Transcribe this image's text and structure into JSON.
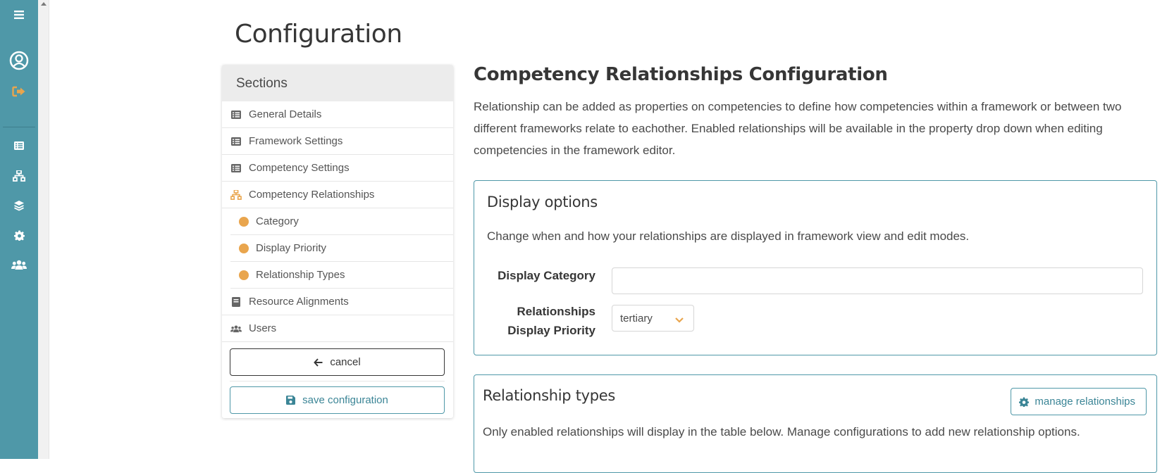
{
  "page": {
    "title": "Configuration"
  },
  "sidebar_rail": {
    "icons": [
      "menu-icon",
      "user-circle-icon",
      "sign-out-icon",
      "list-icon",
      "sitemap-icon",
      "layers-icon",
      "gear-icon",
      "users-icon"
    ]
  },
  "sections": {
    "header": "Sections",
    "items": [
      {
        "label": "General Details",
        "icon": "list-icon"
      },
      {
        "label": "Framework Settings",
        "icon": "list-icon"
      },
      {
        "label": "Competency Settings",
        "icon": "list-icon"
      },
      {
        "label": "Competency Relationships",
        "icon": "sitemap-icon"
      },
      {
        "label": "Category",
        "icon": "dot"
      },
      {
        "label": "Display Priority",
        "icon": "dot"
      },
      {
        "label": "Relationship Types",
        "icon": "dot"
      },
      {
        "label": "Resource Alignments",
        "icon": "book-icon"
      },
      {
        "label": "Users",
        "icon": "users-icon"
      }
    ],
    "cancel_label": "cancel",
    "save_label": "save configuration"
  },
  "main": {
    "title": "Competency Relationships Configuration",
    "description": "Relationship can be added as properties on competencies to define how competencies within a framework or between two different frameworks relate to eachother. Enabled relationships will be available in the property drop down when editing competencies in the framework editor.",
    "display_options": {
      "title": "Display options",
      "description": "Change when and how your relationships are displayed in framework view and edit modes.",
      "category_label": "Display Category",
      "category_value": "",
      "priority_label_line1": "Relationships",
      "priority_label_line2": "Display Priority",
      "priority_value": "tertiary"
    },
    "relationship_types": {
      "title": "Relationship types",
      "manage_label": "manage relationships",
      "description": "Only enabled relationships will display in the table below. Manage configurations to add new relationship options."
    }
  },
  "colors": {
    "rail": "#4f98a8",
    "accent_orange": "#e9a54d",
    "teal_text": "#3b8596"
  }
}
